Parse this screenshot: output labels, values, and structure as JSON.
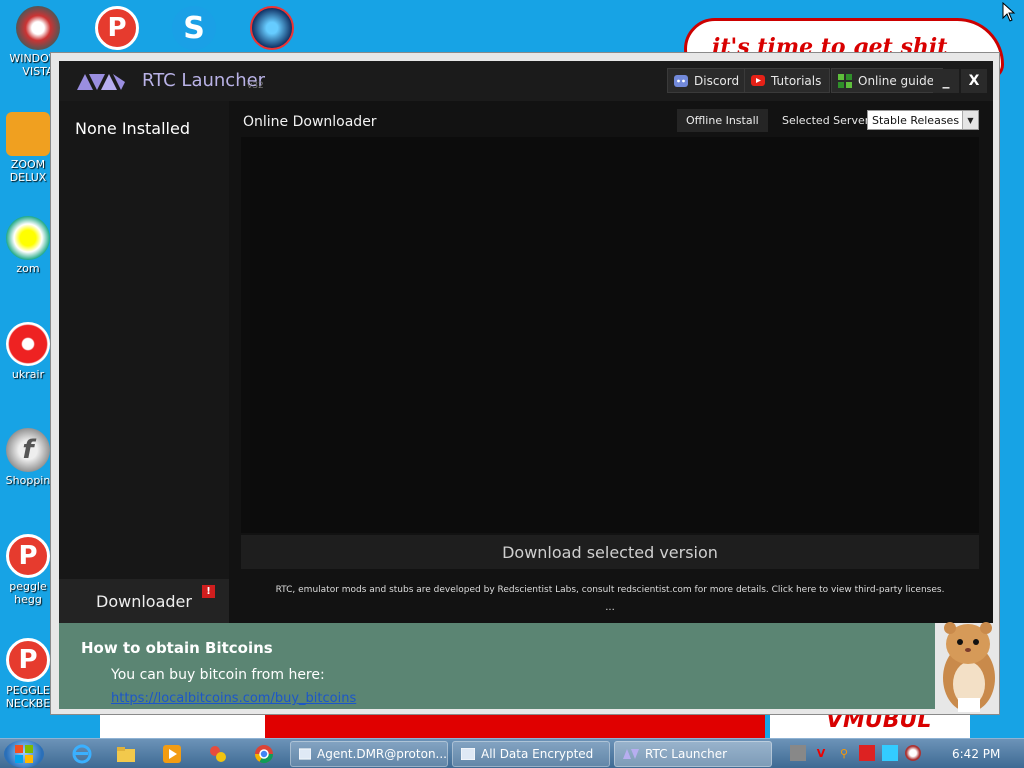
{
  "desktop": {
    "wallpaper_cloud_text": "it's time to get shit",
    "wallpaper_bottom_text": "VMUBUL",
    "icons": [
      {
        "label": "WINDOWS VISTA",
        "glyph": ""
      },
      {
        "label": "",
        "glyph": "P"
      },
      {
        "label": "",
        "glyph": "S"
      },
      {
        "label": "",
        "glyph": ""
      },
      {
        "label": "ZOOM DELUX",
        "glyph": ""
      },
      {
        "label": "zom",
        "glyph": ""
      },
      {
        "label": "ukrair",
        "glyph": ""
      },
      {
        "label": "Shoppin",
        "glyph": "f"
      },
      {
        "label": "peggle hegg",
        "glyph": "P"
      },
      {
        "label": "PEGGLE NECKBE",
        "glyph": "P"
      }
    ]
  },
  "launcher": {
    "title": "RTC Launcher",
    "version": "v32",
    "buttons": {
      "discord": "Discord",
      "tutorials": "Tutorials",
      "online_guide": "Online guide",
      "minimize": "_",
      "close": "X"
    },
    "sidebar": {
      "title": "None Installed",
      "downloader_tab": "Downloader",
      "alert": "!"
    },
    "main": {
      "title": "Online Downloader",
      "offline_install": "Offline Install",
      "server_label": "Selected Server:",
      "server_value": "Stable Releases",
      "download_button": "Download selected version",
      "credits": "RTC, emulator mods and stubs are developed by Redscientist Labs, consult redscientist.com for more details. Click here to view third-party licenses.",
      "dots": "..."
    },
    "colors": {
      "accent": "#9a8ee0",
      "background": "#121212"
    }
  },
  "bitcoin_panel": {
    "title": "How to obtain Bitcoins",
    "text": "You can buy bitcoin from here:",
    "link": "https://localbitcoins.com/buy_bitcoins"
  },
  "taskbar": {
    "tasks": [
      "Agent.DMR@proton...",
      "All Data Encrypted",
      "RTC Launcher"
    ],
    "clock": "6:42 PM"
  }
}
